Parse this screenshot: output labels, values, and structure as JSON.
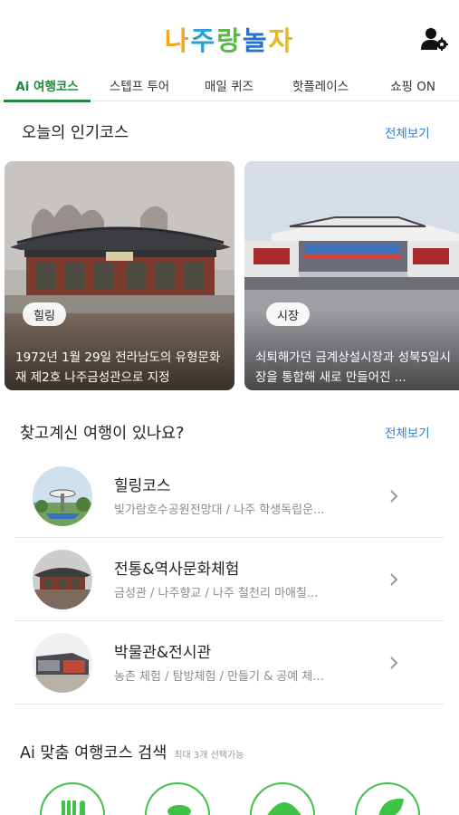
{
  "header": {
    "logo_chars": [
      "나",
      "주",
      "랑",
      "놀",
      "자"
    ],
    "logo_colors": [
      "#f4a51c",
      "#2a9fd8",
      "#58b947",
      "#2c6fc4",
      "#e9b821"
    ],
    "user_icon": "user-settings-icon"
  },
  "tabs": [
    {
      "label": "Ai 여행코스",
      "active": true
    },
    {
      "label": "스텝프 투어",
      "active": false
    },
    {
      "label": "매일 퀴즈",
      "active": false
    },
    {
      "label": "핫플레이스",
      "active": false
    },
    {
      "label": "쇼핑 ON",
      "active": false
    }
  ],
  "popular": {
    "title": "오늘의 인기코스",
    "see_all": "전체보기",
    "cards": [
      {
        "badge": "힐링",
        "description": "1972년 1월 29일 전라남도의 유형문화재 제2호 나주금성관으로 지정",
        "image": "traditional-hanok-hall-photo"
      },
      {
        "badge": "시장",
        "description": "쇠퇴해가던 금계상설시장과 성북5일시장을 통합해 새로 만들어진 ...",
        "image": "market-gate-plaza-photo"
      }
    ]
  },
  "search_trip": {
    "title": "찾고계신 여행이 있나요?",
    "see_all": "전체보기",
    "items": [
      {
        "title": "힐링코스",
        "subtitle": "빛가람호수공원전망대 / 나주 학생독립운...",
        "icon": "observatory-thumbnail"
      },
      {
        "title": "전통&역사문화체험",
        "subtitle": "금성관 / 나주향교 / 나주 철천리 마애칠...",
        "icon": "hanok-thumbnail"
      },
      {
        "title": "박물관&전시관",
        "subtitle": "농촌 체험 / 탐방체험 / 만들기 & 공예 체...",
        "icon": "museum-thumbnail"
      }
    ]
  },
  "ai_search": {
    "title": "Ai 맞춤 여행코스 검색",
    "hint": "최대 3개 선택가능",
    "categories": [
      "food-icon",
      "footprint-icon",
      "umbrella-icon",
      "leaf-icon"
    ]
  },
  "colors": {
    "accent_green": "#1f8a3d",
    "link_blue": "#2d7fd3",
    "category_border": "#3fc245"
  }
}
